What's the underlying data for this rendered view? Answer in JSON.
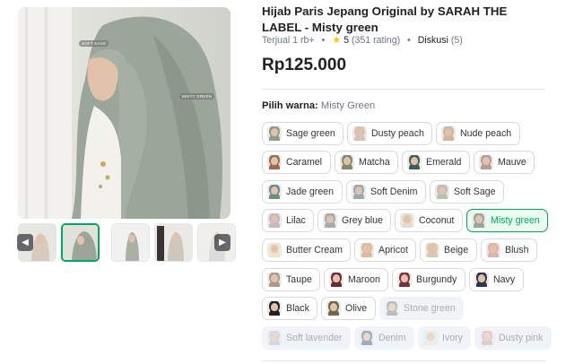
{
  "product": {
    "title": "Hijab Paris Jepang Original by SARAH THE LABEL - Misty green",
    "sold_label": "Terjual",
    "sold_count": "1 rb+",
    "rating": "5",
    "rating_count": "(351 rating)",
    "discussion_label": "Diskusi",
    "discussion_count": "(5)",
    "price": "Rp125.000"
  },
  "gallery": {
    "image_labels": [
      "SOFT SAGE",
      "MISTY GREEN"
    ],
    "thumbnail_count": 5,
    "active_thumbnail": 2,
    "prev_icon": "chevron-left-icon",
    "next_icon": "chevron-right-icon"
  },
  "variant": {
    "label": "Pilih warna:",
    "selected": "Misty Green",
    "options": [
      {
        "name": "Sage green",
        "swatch": "#8f9b8a",
        "state": "normal"
      },
      {
        "name": "Dusty peach",
        "swatch": "#d9c2b5",
        "state": "normal"
      },
      {
        "name": "Nude peach",
        "swatch": "#cdb5a3",
        "state": "normal"
      },
      {
        "name": "Caramel",
        "swatch": "#9a6b4c",
        "state": "normal"
      },
      {
        "name": "Matcha",
        "swatch": "#7f8b66",
        "state": "normal"
      },
      {
        "name": "Emerald",
        "swatch": "#3e5f52",
        "state": "normal"
      },
      {
        "name": "Mauve",
        "swatch": "#b89a98",
        "state": "normal"
      },
      {
        "name": "Jade green",
        "swatch": "#6b8c80",
        "state": "normal"
      },
      {
        "name": "Soft Denim",
        "swatch": "#9aa7b4",
        "state": "normal"
      },
      {
        "name": "Soft Sage",
        "swatch": "#b8c0b0",
        "state": "normal"
      },
      {
        "name": "Lilac",
        "swatch": "#c4b7c8",
        "state": "normal"
      },
      {
        "name": "Grey blue",
        "swatch": "#a3aab3",
        "state": "normal"
      },
      {
        "name": "Coconut",
        "swatch": "#e4ddd2",
        "state": "normal"
      },
      {
        "name": "Misty green",
        "swatch": "#9aa59a",
        "state": "selected"
      },
      {
        "name": "Butter Cream",
        "swatch": "#efe4c8",
        "state": "normal"
      },
      {
        "name": "Apricot",
        "swatch": "#e0b89a",
        "state": "normal"
      },
      {
        "name": "Beige",
        "swatch": "#d8c8b2",
        "state": "normal"
      },
      {
        "name": "Blush",
        "swatch": "#dcb4b0",
        "state": "normal"
      },
      {
        "name": "Taupe",
        "swatch": "#a89a8c",
        "state": "normal"
      },
      {
        "name": "Maroon",
        "swatch": "#6e2a33",
        "state": "normal"
      },
      {
        "name": "Burgundy",
        "swatch": "#7a3040",
        "state": "normal"
      },
      {
        "name": "Navy",
        "swatch": "#2d3550",
        "state": "normal"
      },
      {
        "name": "Black",
        "swatch": "#222222",
        "state": "normal"
      },
      {
        "name": "Olive",
        "swatch": "#6c6a45",
        "state": "normal"
      },
      {
        "name": "Stone green",
        "swatch": "#8e9488",
        "state": "disabled"
      },
      {
        "name": "Soft lavender",
        "swatch": "#c7bfd3",
        "state": "disabled"
      },
      {
        "name": "Denim",
        "swatch": "#5f7290",
        "state": "disabled"
      },
      {
        "name": "Ivory",
        "swatch": "#ece6d6",
        "state": "disabled"
      },
      {
        "name": "Dusty pink",
        "swatch": "#d5aeae",
        "state": "disabled"
      }
    ]
  },
  "colors": {
    "accent": "#00aa5b",
    "selected_bg": "#eafbf0",
    "star": "#ffc400",
    "muted": "#6d7588",
    "disabled_bg": "#f0f3f7"
  }
}
